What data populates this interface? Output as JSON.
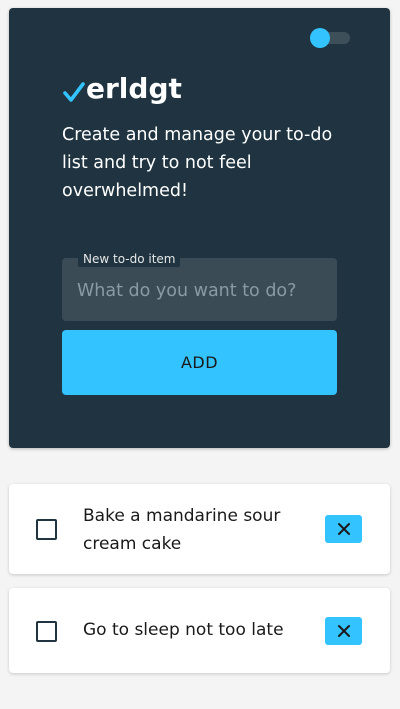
{
  "app": {
    "name": "erldgt",
    "tagline": "Create and manage your to-do list and try to not feel overwhelmed!",
    "logo_icon": "checkmark-icon",
    "accent_color": "#33c3ff",
    "panel_color": "#1f3440"
  },
  "theme_toggle": {
    "icon": "toggle-switch",
    "on": false
  },
  "form": {
    "label": "New to-do item",
    "placeholder": "What do you want to do?",
    "value": "",
    "add_label": "ADD"
  },
  "todos": [
    {
      "text": "Bake a mandarine sour cream cake",
      "done": false,
      "delete_icon": "close-icon"
    },
    {
      "text": "Go to sleep not too late",
      "done": false,
      "delete_icon": "close-icon"
    }
  ]
}
